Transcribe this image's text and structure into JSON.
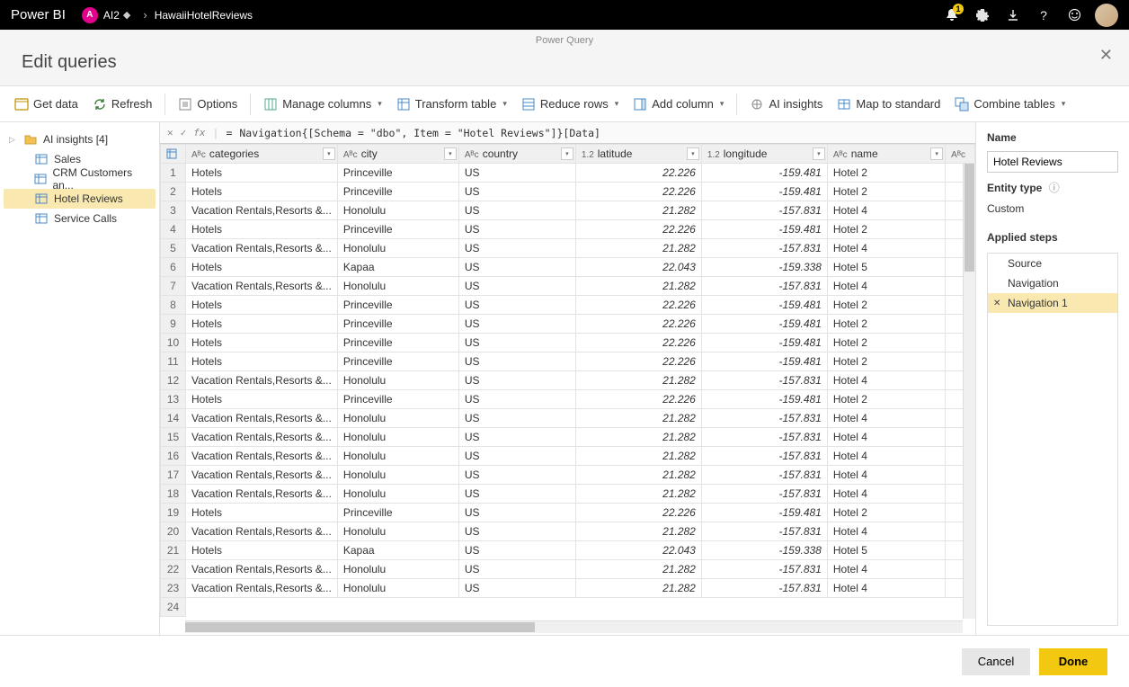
{
  "topbar": {
    "logo": "Power BI",
    "workspace_initial": "A",
    "workspace_name": "AI2",
    "breadcrumb_item": "HawaiiHotelReviews",
    "notif_count": "1"
  },
  "subhead": {
    "pq_label": "Power Query",
    "title": "Edit queries"
  },
  "ribbon": {
    "get_data": "Get data",
    "refresh": "Refresh",
    "options": "Options",
    "manage_columns": "Manage columns",
    "transform_table": "Transform table",
    "reduce_rows": "Reduce rows",
    "add_column": "Add column",
    "ai_insights": "AI insights",
    "map_to_standard": "Map to standard",
    "combine_tables": "Combine tables"
  },
  "nav": {
    "items": [
      {
        "label": "AI insights [4]",
        "folder": true
      },
      {
        "label": "Sales"
      },
      {
        "label": "CRM Customers an..."
      },
      {
        "label": "Hotel Reviews",
        "selected": true
      },
      {
        "label": "Service Calls"
      }
    ]
  },
  "formula": {
    "eq": "=",
    "text": "Navigation{[Schema = \"dbo\", Item = \"Hotel Reviews\"]}[Data]"
  },
  "columns": [
    {
      "type": "ABC",
      "name": "categories",
      "align": "left"
    },
    {
      "type": "ABC",
      "name": "city",
      "align": "left"
    },
    {
      "type": "ABC",
      "name": "country",
      "align": "left"
    },
    {
      "type": "1.2",
      "name": "latitude",
      "align": "right"
    },
    {
      "type": "1.2",
      "name": "longitude",
      "align": "right"
    },
    {
      "type": "ABC",
      "name": "name",
      "align": "left"
    }
  ],
  "rows": [
    [
      "Hotels",
      "Princeville",
      "US",
      "22.226",
      "-159.481",
      "Hotel 2"
    ],
    [
      "Hotels",
      "Princeville",
      "US",
      "22.226",
      "-159.481",
      "Hotel 2"
    ],
    [
      "Vacation Rentals,Resorts &...",
      "Honolulu",
      "US",
      "21.282",
      "-157.831",
      "Hotel 4"
    ],
    [
      "Hotels",
      "Princeville",
      "US",
      "22.226",
      "-159.481",
      "Hotel 2"
    ],
    [
      "Vacation Rentals,Resorts &...",
      "Honolulu",
      "US",
      "21.282",
      "-157.831",
      "Hotel 4"
    ],
    [
      "Hotels",
      "Kapaa",
      "US",
      "22.043",
      "-159.338",
      "Hotel 5"
    ],
    [
      "Vacation Rentals,Resorts &...",
      "Honolulu",
      "US",
      "21.282",
      "-157.831",
      "Hotel 4"
    ],
    [
      "Hotels",
      "Princeville",
      "US",
      "22.226",
      "-159.481",
      "Hotel 2"
    ],
    [
      "Hotels",
      "Princeville",
      "US",
      "22.226",
      "-159.481",
      "Hotel 2"
    ],
    [
      "Hotels",
      "Princeville",
      "US",
      "22.226",
      "-159.481",
      "Hotel 2"
    ],
    [
      "Hotels",
      "Princeville",
      "US",
      "22.226",
      "-159.481",
      "Hotel 2"
    ],
    [
      "Vacation Rentals,Resorts &...",
      "Honolulu",
      "US",
      "21.282",
      "-157.831",
      "Hotel 4"
    ],
    [
      "Hotels",
      "Princeville",
      "US",
      "22.226",
      "-159.481",
      "Hotel 2"
    ],
    [
      "Vacation Rentals,Resorts &...",
      "Honolulu",
      "US",
      "21.282",
      "-157.831",
      "Hotel 4"
    ],
    [
      "Vacation Rentals,Resorts &...",
      "Honolulu",
      "US",
      "21.282",
      "-157.831",
      "Hotel 4"
    ],
    [
      "Vacation Rentals,Resorts &...",
      "Honolulu",
      "US",
      "21.282",
      "-157.831",
      "Hotel 4"
    ],
    [
      "Vacation Rentals,Resorts &...",
      "Honolulu",
      "US",
      "21.282",
      "-157.831",
      "Hotel 4"
    ],
    [
      "Vacation Rentals,Resorts &...",
      "Honolulu",
      "US",
      "21.282",
      "-157.831",
      "Hotel 4"
    ],
    [
      "Hotels",
      "Princeville",
      "US",
      "22.226",
      "-159.481",
      "Hotel 2"
    ],
    [
      "Vacation Rentals,Resorts &...",
      "Honolulu",
      "US",
      "21.282",
      "-157.831",
      "Hotel 4"
    ],
    [
      "Hotels",
      "Kapaa",
      "US",
      "22.043",
      "-159.338",
      "Hotel 5"
    ],
    [
      "Vacation Rentals,Resorts &...",
      "Honolulu",
      "US",
      "21.282",
      "-157.831",
      "Hotel 4"
    ],
    [
      "Vacation Rentals,Resorts &...",
      "Honolulu",
      "US",
      "21.282",
      "-157.831",
      "Hotel 4"
    ]
  ],
  "rpanel": {
    "name_label": "Name",
    "name_value": "Hotel Reviews",
    "entity_type_label": "Entity type",
    "entity_type_value": "Custom",
    "applied_steps_label": "Applied steps",
    "steps": [
      {
        "label": "Source"
      },
      {
        "label": "Navigation"
      },
      {
        "label": "Navigation 1",
        "selected": true,
        "removable": true
      }
    ]
  },
  "footer": {
    "cancel": "Cancel",
    "done": "Done"
  }
}
